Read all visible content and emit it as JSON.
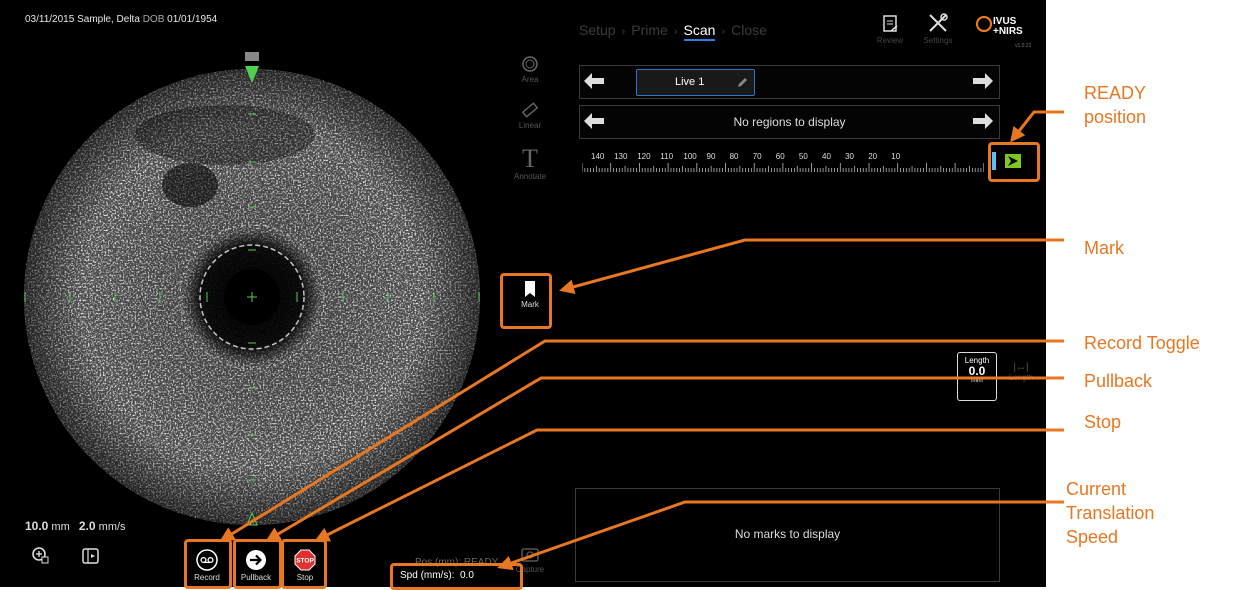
{
  "patient": {
    "date_name": "03/11/2015 Sample, Delta",
    "dob_label": "DOB",
    "dob": "01/01/1954"
  },
  "workflow": {
    "steps": [
      "Setup",
      "Prime",
      "Scan",
      "Close"
    ],
    "active": "Scan"
  },
  "top_icons": {
    "review": "Review",
    "settings": "Settings"
  },
  "logo": {
    "line1": "IVUS",
    "line2": "+NIRS",
    "version": "v1.0.21"
  },
  "tools": {
    "area": "Area",
    "linear": "Linear",
    "annotate": "Annotate",
    "mark": "Mark",
    "capture": "Capture"
  },
  "tabs": {
    "live_label": "Live 1"
  },
  "regions": {
    "empty_text": "No regions to display"
  },
  "ruler": {
    "labels": [
      "140",
      "130",
      "120",
      "110",
      "100",
      "90",
      "80",
      "70",
      "60",
      "50",
      "40",
      "30",
      "20",
      "10"
    ],
    "unit": "mm"
  },
  "length": {
    "title": "Length",
    "value": "0.0",
    "unit": "mm",
    "tool_label": "Length"
  },
  "marks": {
    "empty_text": "No marks to display"
  },
  "scale": {
    "depth_value": "10.0",
    "depth_unit": "mm",
    "speed_value": "2.0",
    "speed_unit": "mm/s"
  },
  "controls": {
    "record": "Record",
    "pullback": "Pullback",
    "stop": "Stop",
    "stop_badge": "STOP"
  },
  "status": {
    "pos_label": "Pos (mm):",
    "pos_value": "READY",
    "spd_label": "Spd (mm/s):",
    "spd_value": "0.0"
  },
  "annotations": {
    "ready_line1": "READY",
    "ready_line2": "position",
    "mark": "Mark",
    "record_toggle": "Record Toggle",
    "pullback": "Pullback",
    "stop": "Stop",
    "speed_line1": "Current",
    "speed_line2": "Translation",
    "speed_line3": "Speed"
  },
  "colors": {
    "accent_orange": "#e87722",
    "tab_blue": "#2a78c8",
    "ivus_green": "#4fd04f",
    "stop_red": "#e03030"
  }
}
